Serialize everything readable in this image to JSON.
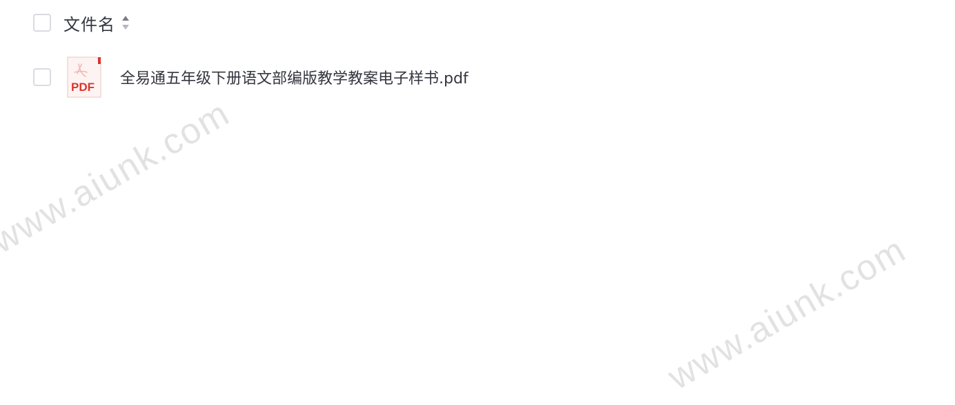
{
  "table": {
    "header": {
      "column_title": "文件名",
      "sort_icon": "sort-icon"
    },
    "rows": [
      {
        "file_icon": "pdf-file-icon",
        "file_badge": "PDF",
        "name": "全易通五年级下册语文部编版教学教案电子样书.pdf"
      }
    ]
  },
  "watermarks": [
    "www.aiunk.com",
    "www.aiunk.com"
  ],
  "colors": {
    "pdf_red": "#d9352e",
    "text": "#34363f",
    "checkbox_border": "#d9dbe1"
  }
}
